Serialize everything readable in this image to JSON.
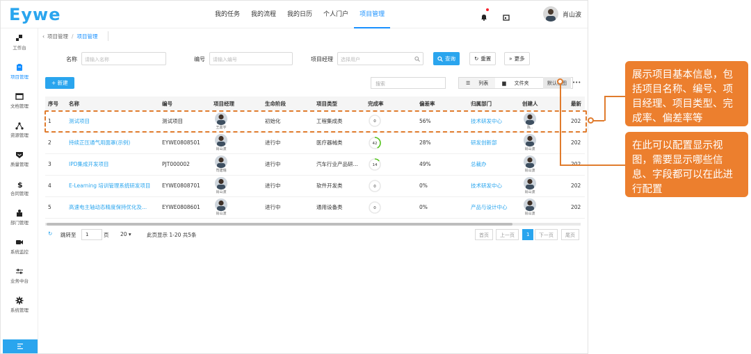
{
  "brand": {
    "logo": "Eywe",
    "accent": "#2aa5ee",
    "callout_color": "#ec7f2e"
  },
  "nav": {
    "items": [
      "我的任务",
      "我的流程",
      "我的日历",
      "个人门户",
      "项目管理"
    ],
    "active": "项目管理"
  },
  "user": {
    "name": "肖山波"
  },
  "sidebar": {
    "items": [
      {
        "label": "工作台",
        "icon": "dashboard-icon"
      },
      {
        "label": "项目管理",
        "icon": "clipboard-icon",
        "active": true
      },
      {
        "label": "文档管理",
        "icon": "folder-icon"
      },
      {
        "label": "资源管理",
        "icon": "network-icon"
      },
      {
        "label": "质量管理",
        "icon": "shield-icon"
      },
      {
        "label": "合同管理",
        "icon": "dollar-icon"
      },
      {
        "label": "部门管理",
        "icon": "department-icon"
      },
      {
        "label": "系统监控",
        "icon": "video-icon"
      },
      {
        "label": "业务中台",
        "icon": "sliders-icon"
      },
      {
        "label": "系统管理",
        "icon": "gear-icon"
      }
    ]
  },
  "breadcrumb": {
    "root": "项目管理",
    "sep": "/",
    "current": "项目管理"
  },
  "filters": {
    "name_label": "名称",
    "name_placeholder": "请输入名称",
    "code_label": "编号",
    "code_placeholder": "请输入编号",
    "mgr_label": "项目经理",
    "mgr_placeholder": "选择用户",
    "query": "查询",
    "reset": "重置",
    "more": "更多"
  },
  "toolbar": {
    "new": "+ 新建",
    "search": "搜索",
    "list": "列表",
    "folder": "文件夹",
    "report": "报表",
    "default_view": "默认视图",
    "dots": "•••"
  },
  "table": {
    "headers": [
      "序号",
      "名称",
      "编号",
      "项目经理",
      "生命阶段",
      "项目类型",
      "完成率",
      "偏差率",
      "归属部门",
      "创建人",
      "最新"
    ],
    "rows": [
      {
        "idx": "1",
        "name": "测试项目",
        "code": "测试项目",
        "mgr": "王嘉宇",
        "stage": "初始化",
        "type": "工程集成类",
        "rate": 0,
        "dev": "56%",
        "dept": "技术研发中心",
        "creator": "陈..",
        "latest": "202"
      },
      {
        "idx": "2",
        "name": "持续正压通气用面罩(示例)",
        "code": "EYWE0808501",
        "mgr": "肖山波",
        "stage": "进行中",
        "type": "医疗器械类",
        "rate": 42,
        "dev": "28%",
        "dept": "研发创新部",
        "creator": "肖山波",
        "latest": "202"
      },
      {
        "idx": "3",
        "name": "IPD集成开发项目",
        "code": "PJT000002",
        "mgr": "司建瑞",
        "stage": "进行中",
        "type": "汽车行业产品研发...",
        "rate": 14,
        "dev": "49%",
        "dept": "总裁办",
        "creator": "肖山波",
        "latest": "202"
      },
      {
        "idx": "4",
        "name": "E-Learning 培训管理系统研发项目",
        "code": "EYWE0808701",
        "mgr": "肖山波",
        "stage": "进行中",
        "type": "软件开发类",
        "rate": 0,
        "dev": "0%",
        "dept": "技术研发中心",
        "creator": "肖山波",
        "latest": "202"
      },
      {
        "idx": "5",
        "name": "高速电主轴动态精度保持优化及...",
        "code": "EYWE0808601",
        "mgr": "肖山波",
        "stage": "进行中",
        "type": "通用设备类",
        "rate": 0,
        "dev": "0%",
        "dept": "产品与设计中心",
        "creator": "肖山波",
        "latest": "202"
      }
    ]
  },
  "pager": {
    "jump": "跳转至",
    "page": "1",
    "page_unit": "页",
    "size": "20 ▾",
    "summary": "此页显示 1-20 共5条",
    "first": "首页",
    "prev": "上一页",
    "current": "1",
    "next": "下一页",
    "last": "尾页"
  },
  "callouts": {
    "one": "展示项目基本信息，包括项目名称、编号、项目经理、项目类型、完成率、偏差率等",
    "two": "在此可以配置显示视图，需要显示哪些信息、字段都可以在此进行配置"
  }
}
